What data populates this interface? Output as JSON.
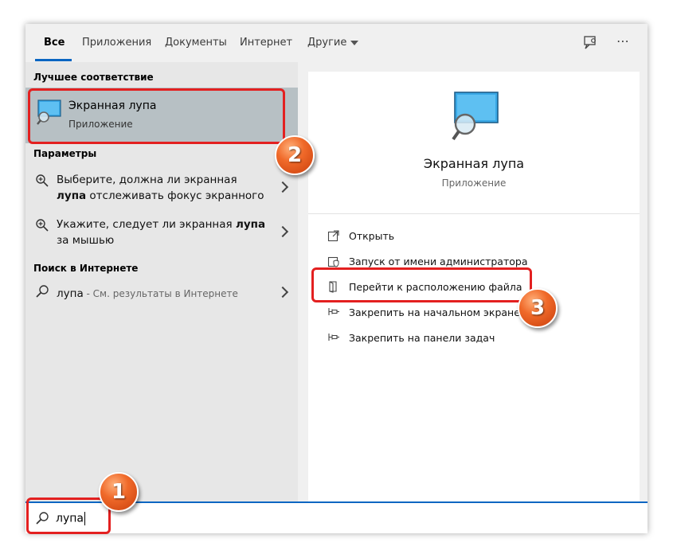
{
  "tabs": [
    {
      "label": "Все",
      "active": true
    },
    {
      "label": "Приложения"
    },
    {
      "label": "Документы"
    },
    {
      "label": "Интернет"
    },
    {
      "label": "Другие"
    }
  ],
  "header_icons": {
    "feedback": "feedback-icon",
    "more": "⋯"
  },
  "best_match": {
    "section_title": "Лучшее соответствие",
    "title": "Экранная лупа",
    "subtitle": "Приложение",
    "icon": "magnifier-app-icon"
  },
  "settings": {
    "section_title": "Параметры",
    "items": [
      {
        "prefix": "Выберите, должна ли экранная",
        "bold": "лупа",
        "suffix": " отслеживать фокус экранного",
        "icon": "zoom-in-icon"
      },
      {
        "prefix": "Укажите, следует ли экранная",
        "bold": "лупа",
        "suffix": "за мышью",
        "icon": "zoom-in-icon"
      }
    ]
  },
  "web_search": {
    "section_title": "Поиск в Интернете",
    "query": "лупа",
    "suffix": " - См. результаты в Интернете",
    "icon": "search-icon"
  },
  "preview": {
    "title": "Экранная лупа",
    "subtitle": "Приложение",
    "actions": [
      {
        "label": "Открыть",
        "icon": "open-icon"
      },
      {
        "label": "Запуск от имени администратора",
        "icon": "admin-run-icon"
      },
      {
        "label": "Перейти к расположению файла",
        "icon": "file-location-icon"
      },
      {
        "label": "Закрепить на начальном экране",
        "icon": "pin-icon"
      },
      {
        "label": "Закрепить на панели задач",
        "icon": "pin-icon"
      }
    ]
  },
  "search": {
    "value": "лупа",
    "icon": "search-icon"
  },
  "annotations": [
    "1",
    "2",
    "3"
  ],
  "colors": {
    "accent": "#0a66c2",
    "highlight": "#e32020",
    "badge": "#f06a2a",
    "selected_bg": "#b7c0c4"
  }
}
